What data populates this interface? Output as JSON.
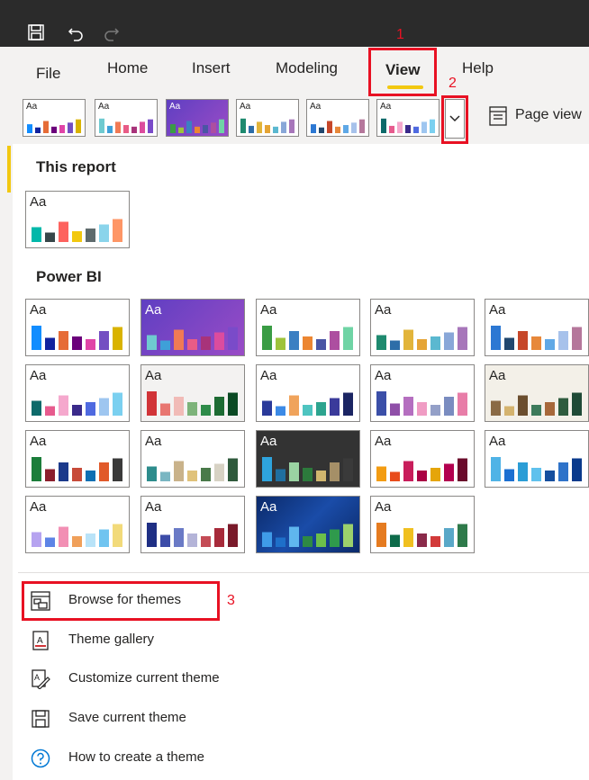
{
  "menu": {
    "items": [
      "File",
      "Home",
      "Insert",
      "Modeling",
      "View",
      "Help"
    ],
    "active": "View"
  },
  "ribbon": {
    "page_view_label": "Page view"
  },
  "annotations": {
    "step1": "1",
    "step2": "2",
    "step3": "3"
  },
  "panel": {
    "this_report_heading": "This report",
    "power_bi_heading": "Power BI",
    "theme_sample_text": "Aa",
    "actions": [
      {
        "label": "Browse for themes",
        "icon": "browse-themes-icon"
      },
      {
        "label": "Theme gallery",
        "icon": "theme-gallery-icon"
      },
      {
        "label": "Customize current theme",
        "icon": "customize-theme-icon"
      },
      {
        "label": "Save current theme",
        "icon": "save-theme-icon"
      },
      {
        "label": "How to create a theme",
        "icon": "help-circle-icon"
      }
    ]
  },
  "colors": {
    "accent_yellow": "#f2c811",
    "annotation_red": "#e81123",
    "titlebar": "#2b2b2b"
  }
}
